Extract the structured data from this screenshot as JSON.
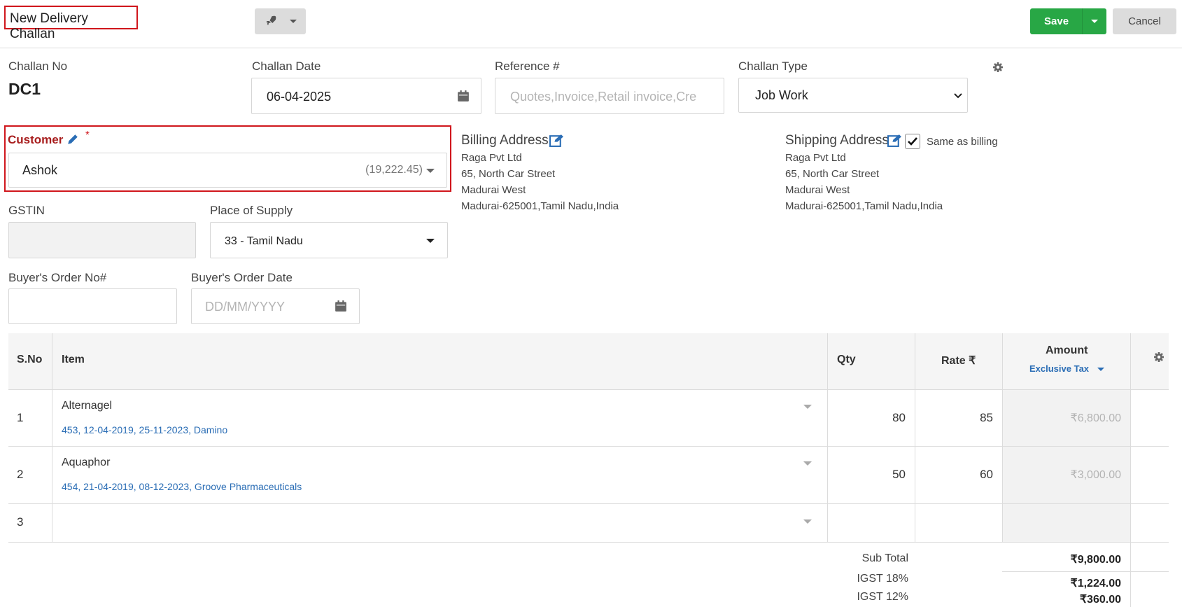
{
  "header": {
    "title": "New Delivery Challan",
    "save_label": "Save",
    "cancel_label": "Cancel"
  },
  "form": {
    "challan_no_label": "Challan No",
    "challan_no_value": "DC1",
    "challan_date_label": "Challan Date",
    "challan_date_value": "06-04-2025",
    "reference_label": "Reference #",
    "reference_placeholder": "Quotes,Invoice,Retail invoice,Cre",
    "challan_type_label": "Challan Type",
    "challan_type_value": "Job Work",
    "customer_label": "Customer",
    "customer_required": "*",
    "customer_value": "Ashok",
    "customer_balance": "(19,222.45)",
    "gstin_label": "GSTIN",
    "gstin_value": "",
    "place_of_supply_label": "Place of Supply",
    "place_of_supply_value": "33 - Tamil Nadu",
    "buyers_order_no_label": "Buyer's Order No#",
    "buyers_order_no_value": "",
    "buyers_order_date_label": "Buyer's Order Date",
    "buyers_order_date_placeholder": "DD/MM/YYYY"
  },
  "billing": {
    "title": "Billing Address",
    "lines": [
      "Raga Pvt Ltd",
      "65, North Car Street",
      "Madurai West",
      "Madurai-625001,Tamil Nadu,India"
    ]
  },
  "shipping": {
    "title": "Shipping Address",
    "same_as_billing_label": "Same as billing",
    "same_as_billing_checked": true,
    "lines": [
      "Raga Pvt Ltd",
      "65, North Car Street",
      "Madurai West",
      "Madurai-625001,Tamil Nadu,India"
    ]
  },
  "table": {
    "headers": {
      "sno": "S.No",
      "item": "Item",
      "qty": "Qty",
      "rate": "Rate ₹",
      "amount": "Amount",
      "tax_mode": "Exclusive Tax"
    },
    "rows": [
      {
        "sno": "1",
        "item": "Alternagel",
        "meta": "453, 12-04-2019, 25-11-2023, Damino",
        "qty": "80",
        "rate": "85",
        "amount": "₹6,800.00"
      },
      {
        "sno": "2",
        "item": "Aquaphor",
        "meta": "454, 21-04-2019, 08-12-2023, Groove Pharmaceuticals",
        "qty": "50",
        "rate": "60",
        "amount": "₹3,000.00"
      },
      {
        "sno": "3",
        "item": "",
        "meta": "",
        "qty": "",
        "rate": "",
        "amount": ""
      }
    ]
  },
  "totals": {
    "sub_total_label": "Sub Total",
    "sub_total_value": "₹9,800.00",
    "igst18_label": "IGST 18%",
    "igst18_value": "₹1,224.00",
    "igst12_label": "IGST 12%",
    "igst12_value": "₹360.00"
  },
  "colors": {
    "save_green": "#28a745",
    "highlight_red": "#d0161c",
    "link_blue": "#2a6db5"
  }
}
